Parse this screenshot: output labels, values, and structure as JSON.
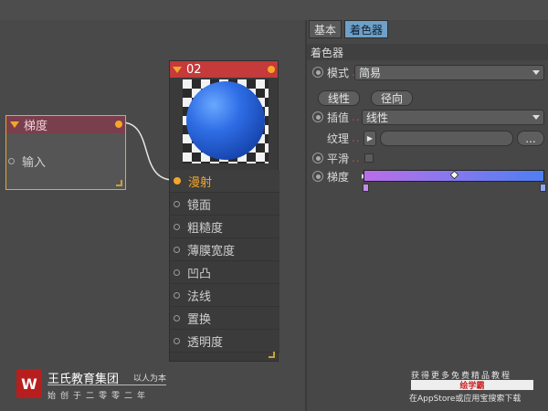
{
  "tabs": [
    {
      "label": "基本"
    },
    {
      "label": "着色器"
    }
  ],
  "panel": {
    "section_title": "着色器",
    "mode": {
      "label": "模式",
      "value": "简易"
    },
    "buttons": {
      "linear": "线性",
      "radial": "径向"
    },
    "interpolation": {
      "label": "插值",
      "value": "线性"
    },
    "texture": {
      "label": "纹理",
      "more": "..."
    },
    "smooth": {
      "label": "平滑"
    },
    "gradient": {
      "label": "梯度",
      "colors": [
        "#b86ee8",
        "#4f7ef2"
      ]
    }
  },
  "gradient_node": {
    "title": "梯度",
    "input_label": "输入"
  },
  "material_node": {
    "title": "02",
    "channels": [
      "漫射",
      "镜面",
      "粗糙度",
      "薄膜宽度",
      "凹凸",
      "法线",
      "置换",
      "透明度"
    ],
    "active_channel": "漫射",
    "sphere_color": "#2f6ee6"
  },
  "watermark": {
    "logo": "W",
    "brand": "王氏教育集团",
    "motto": "以人为本",
    "year_line": "始创于二零零二年",
    "right_line1": "获得更多免费精品教程",
    "right_line2": "绘学霸",
    "right_line3": "在AppStore或应用宝搜索下载"
  }
}
